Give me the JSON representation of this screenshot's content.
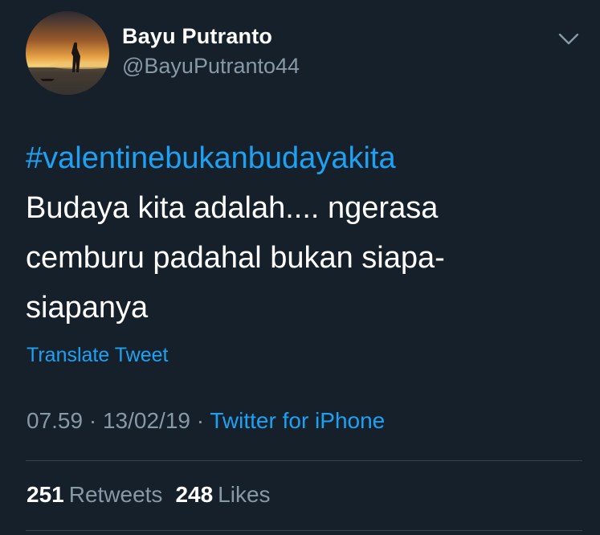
{
  "user": {
    "display_name": "Bayu Putranto",
    "handle": "@BayuPutranto44",
    "avatar_icon": "profile-photo"
  },
  "tweet": {
    "hashtag": "#valentinebukanbudayakita",
    "text": "Budaya kita adalah.... ngerasa cemburu padahal bukan siapa-siapanya",
    "translate_label": "Translate Tweet",
    "time": "07.59",
    "date": "13/02/19",
    "separator": "·",
    "source": "Twitter for iPhone"
  },
  "stats": {
    "retweets_count": "251",
    "retweets_label": "Retweets",
    "likes_count": "248",
    "likes_label": "Likes"
  },
  "colors": {
    "background": "#15202b",
    "accent": "#1da1f2",
    "muted": "#8899a6",
    "divider": "#38444d"
  },
  "icons": {
    "menu": "chevron-down-icon"
  }
}
